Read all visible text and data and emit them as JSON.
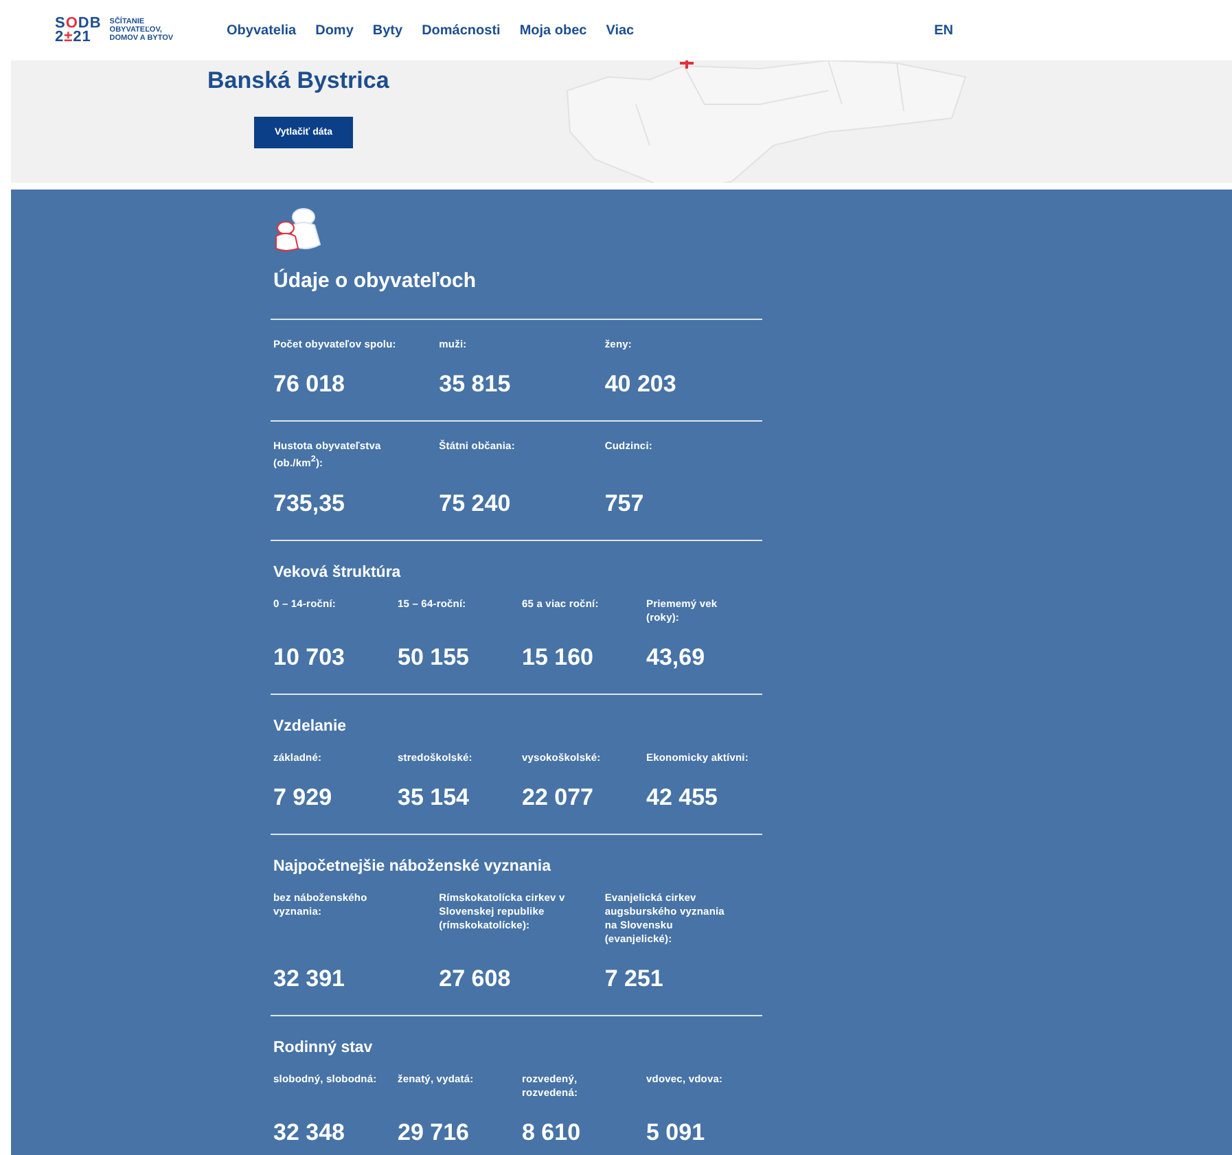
{
  "logo": {
    "mark_top": [
      {
        "text": "S",
        "accent": false
      },
      {
        "text": "O",
        "accent": true
      },
      {
        "text": "DB",
        "accent": false
      }
    ],
    "mark_bottom": [
      {
        "text": "2",
        "accent": false
      },
      {
        "text": "±",
        "accent": true
      },
      {
        "text": "21",
        "accent": false
      }
    ],
    "wordmark": [
      "SČÍTANIE",
      "OBYVATEĽOV,",
      "DOMOV A BYTOV"
    ]
  },
  "nav": [
    {
      "label": "Obyvatelia"
    },
    {
      "label": "Domy"
    },
    {
      "label": "Byty"
    },
    {
      "label": "Domácnosti"
    },
    {
      "label": "Moja obec"
    },
    {
      "label": "Viac"
    }
  ],
  "language": "EN",
  "hero": {
    "title": "Banská Bystrica",
    "print_button": "Vytlačiť dáta"
  },
  "section": {
    "title": "Údaje o obyvateľoch",
    "groups": [
      {
        "items": [
          {
            "label": "Počet obyvateľov spolu:",
            "value": "76 018"
          },
          {
            "label": "muži:",
            "value": "35 815"
          },
          {
            "label": "ženy:",
            "value": "40 203"
          }
        ]
      },
      {
        "items": [
          {
            "label": "Hustota obyvateľstva (ob./km$^{2}$):",
            "value": "735,35"
          },
          {
            "label": "Štátni občania:",
            "value": "75 240"
          },
          {
            "label": "Cudzinci:",
            "value": "757"
          }
        ]
      },
      {
        "title": "Veková štruktúra",
        "items": [
          {
            "label": "0 – 14-roční:",
            "value": "10 703"
          },
          {
            "label": "15 – 64-roční:",
            "value": "50 155"
          },
          {
            "label": "65 a viac roční:",
            "value": "15 160"
          },
          {
            "label": "Priememý vek (roky):",
            "value": "43,69"
          }
        ]
      },
      {
        "title": "Vzdelanie",
        "items": [
          {
            "label": "základné:",
            "value": "7 929"
          },
          {
            "label": "stredoškolské:",
            "value": "35 154"
          },
          {
            "label": "vysokoškolské:",
            "value": "22 077"
          },
          {
            "label": "Ekonomicky aktívni:",
            "value": "42 455"
          }
        ]
      },
      {
        "title": "Najpočetnejšie náboženské vyznania",
        "items": [
          {
            "label": "bez náboženského vyznania:",
            "value": "32 391"
          },
          {
            "label": "Rímskokatolícka cirkev v Slovenskej republike (rímskokatolícke):",
            "value": "27 608"
          },
          {
            "label": "Evanjelická cirkev augsburského vyznania na Slovensku (evanjelické):",
            "value": "7 251"
          }
        ]
      },
      {
        "title": "Rodinný stav",
        "items": [
          {
            "label": "slobodný, slobodná:",
            "value": "32 348"
          },
          {
            "label": "ženatý, vydatá:",
            "value": "29 716"
          },
          {
            "label": "rozvedený, rozvedená:",
            "value": "8 610"
          },
          {
            "label": "vdovec, vdova:",
            "value": "5 091"
          }
        ]
      }
    ]
  }
}
